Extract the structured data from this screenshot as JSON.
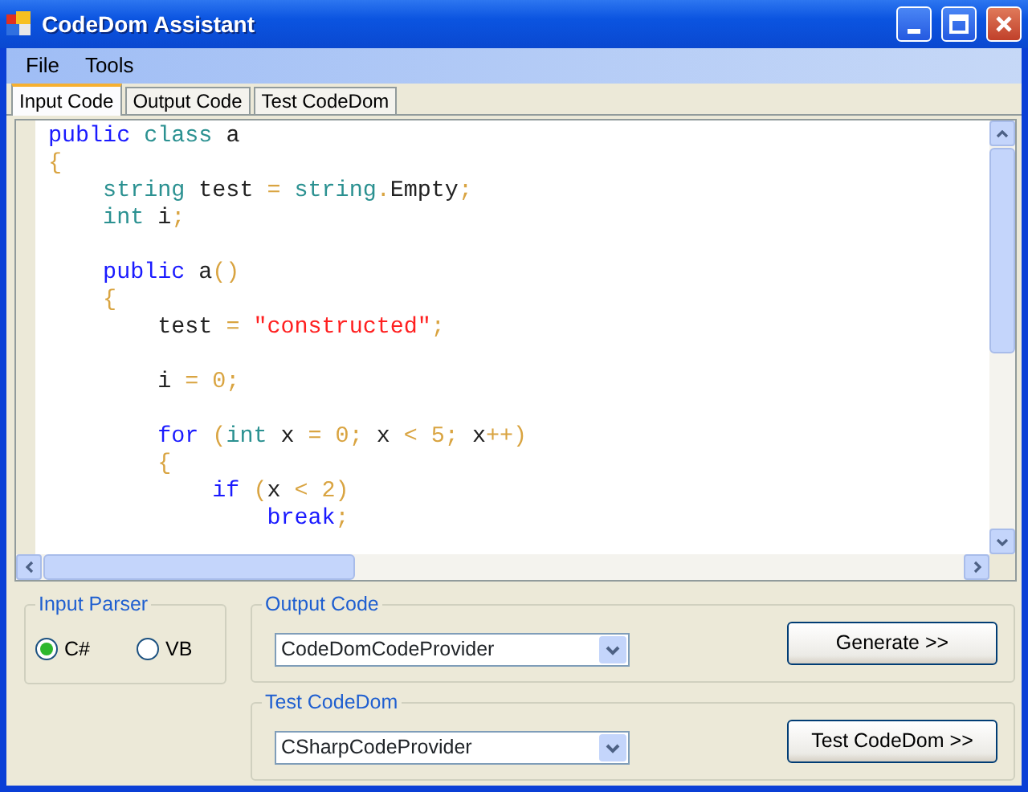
{
  "window": {
    "title": "CodeDom Assistant"
  },
  "menu": [
    "File",
    "Tools"
  ],
  "tabs": [
    {
      "label": "Input Code",
      "selected": true
    },
    {
      "label": "Output Code",
      "selected": false
    },
    {
      "label": "Test CodeDom",
      "selected": false
    }
  ],
  "code_lines": [
    {
      "kind": "code",
      "tokens": [
        {
          "kind": "keyword",
          "text": "public "
        },
        {
          "kind": "type",
          "text": "class "
        },
        {
          "kind": "plain",
          "text": "a"
        }
      ]
    },
    {
      "kind": "code",
      "tokens": [
        {
          "kind": "op",
          "text": "{"
        }
      ]
    },
    {
      "kind": "code",
      "tokens": [
        {
          "kind": "type",
          "text": "    string "
        },
        {
          "kind": "plain",
          "text": "test "
        },
        {
          "kind": "op",
          "text": "= "
        },
        {
          "kind": "type",
          "text": "string"
        },
        {
          "kind": "op",
          "text": "."
        },
        {
          "kind": "plain",
          "text": "Empty"
        },
        {
          "kind": "op",
          "text": ";"
        }
      ]
    },
    {
      "kind": "code",
      "tokens": [
        {
          "kind": "type",
          "text": "    int "
        },
        {
          "kind": "plain",
          "text": "i"
        },
        {
          "kind": "op",
          "text": ";"
        }
      ]
    },
    {
      "kind": "blank"
    },
    {
      "kind": "code",
      "tokens": [
        {
          "kind": "keyword",
          "text": "    public "
        },
        {
          "kind": "plain",
          "text": "a"
        },
        {
          "kind": "op",
          "text": "()"
        }
      ]
    },
    {
      "kind": "code",
      "tokens": [
        {
          "kind": "op",
          "text": "    {"
        }
      ]
    },
    {
      "kind": "code",
      "tokens": [
        {
          "kind": "plain",
          "text": "        test "
        },
        {
          "kind": "op",
          "text": "= "
        },
        {
          "kind": "string",
          "text": "\"constructed\""
        },
        {
          "kind": "op",
          "text": ";"
        }
      ]
    },
    {
      "kind": "blank"
    },
    {
      "kind": "code",
      "tokens": [
        {
          "kind": "plain",
          "text": "        i "
        },
        {
          "kind": "op",
          "text": "= 0;"
        }
      ]
    },
    {
      "kind": "blank"
    },
    {
      "kind": "code",
      "tokens": [
        {
          "kind": "keyword",
          "text": "        for "
        },
        {
          "kind": "op",
          "text": "("
        },
        {
          "kind": "type",
          "text": "int "
        },
        {
          "kind": "plain",
          "text": "x "
        },
        {
          "kind": "op",
          "text": "= 0; "
        },
        {
          "kind": "plain",
          "text": "x "
        },
        {
          "kind": "op",
          "text": "< 5; "
        },
        {
          "kind": "plain",
          "text": "x"
        },
        {
          "kind": "op",
          "text": "++)"
        }
      ]
    },
    {
      "kind": "code",
      "tokens": [
        {
          "kind": "op",
          "text": "        {"
        }
      ]
    },
    {
      "kind": "code",
      "tokens": [
        {
          "kind": "keyword",
          "text": "            if "
        },
        {
          "kind": "op",
          "text": "("
        },
        {
          "kind": "plain",
          "text": "x "
        },
        {
          "kind": "op",
          "text": "< 2)"
        }
      ]
    },
    {
      "kind": "code",
      "tokens": [
        {
          "kind": "keyword",
          "text": "                break"
        },
        {
          "kind": "op",
          "text": ";"
        }
      ]
    }
  ],
  "input_parser": {
    "title": "Input Parser",
    "options": [
      {
        "label": "C#",
        "selected": true
      },
      {
        "label": "VB",
        "selected": false
      }
    ]
  },
  "output_code": {
    "title": "Output Code",
    "provider": "CodeDomCodeProvider",
    "button": "Generate >>"
  },
  "test_codedom": {
    "title": "Test CodeDom",
    "provider": "CSharpCodeProvider",
    "button": "Test CodeDom >>"
  }
}
